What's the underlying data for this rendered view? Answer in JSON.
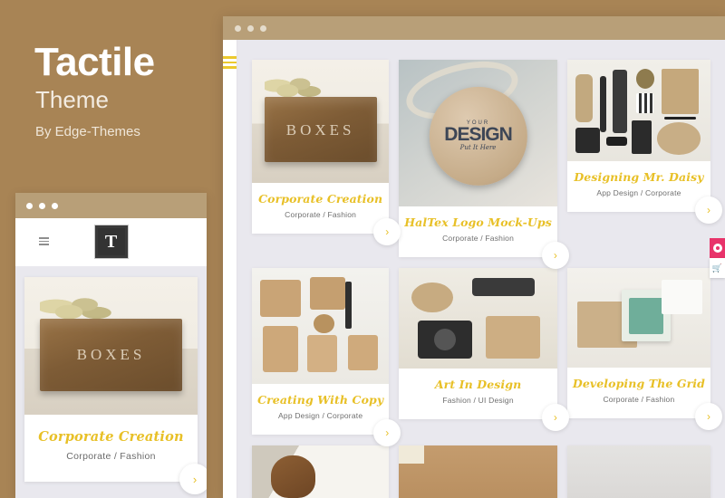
{
  "promo": {
    "title": "Tactile",
    "subtitle": "Theme",
    "byline": "By Edge-Themes"
  },
  "colors": {
    "page_background": "#a88455",
    "browser_chrome": "#b89f78",
    "content_background": "#e9e8ee",
    "accent_gold": "#e8c027",
    "envato_pink": "#e8336a",
    "logo_dark": "#333333"
  },
  "mobile_preview": {
    "window_dots": 3,
    "menu_icon": "hamburger-icon",
    "logo_letter": "T",
    "card": {
      "title": "Corporate Creation",
      "category": "Corporate / Fashion",
      "arrow": "›",
      "image_alt": "wooden BOXES crate with dried flowers"
    }
  },
  "desktop_preview": {
    "window_dots": 3,
    "menu_icon": "hamburger-icon",
    "cards": [
      {
        "title": "Corporate Creation",
        "category": "Corporate / Fashion",
        "arrow": "›",
        "art": "art-box",
        "thumb_height": 136,
        "image_alt": "wooden BOXES crate with dried flowers"
      },
      {
        "title": "HalTex Logo Mock-Ups",
        "category": "Corporate / Fashion",
        "arrow": "›",
        "art": "art-tag",
        "thumb_height": 162,
        "image_alt": "round wooden tag reading YOUR DESIGN Put It Here"
      },
      {
        "title": "Designing Mr. Daisy",
        "category": "App Design / Corporate",
        "arrow": "›",
        "art": "art-flat",
        "thumb_height": 112,
        "image_alt": "flat-lay of rope, hammer, compass, notebook"
      },
      {
        "title": "Creating With Copy",
        "category": "App Design / Corporate",
        "arrow": "›",
        "art": "art-paper",
        "thumb_height": 128,
        "image_alt": "kraft paper boxes and notepad flat-lay"
      },
      {
        "title": "Art In Design",
        "category": "Fashion / UI Design",
        "arrow": "›",
        "art": "art-desk",
        "thumb_height": 111,
        "image_alt": "camera, glasses and rope on desk"
      },
      {
        "title": "Developing The Grid",
        "category": "Corporate / Fashion",
        "arrow": "›",
        "art": "art-green",
        "thumb_height": 110,
        "image_alt": "green branded package box with card"
      }
    ],
    "partial_row": [
      {
        "art": "art-wood2",
        "image_alt": "wooden knob on white surface"
      },
      {
        "art": "art-kraft",
        "image_alt": "kraft cardboard texture"
      },
      {
        "art": "art-gray",
        "image_alt": "light gray product surface"
      }
    ],
    "tag_art": {
      "line1": "YOUR",
      "line2": "DESIGN",
      "line3": "Put It Here"
    },
    "box_art_label": "BOXES"
  },
  "side_buttons": [
    {
      "name": "envato-button",
      "icon": "envato-circle-icon"
    },
    {
      "name": "cart-button",
      "icon": "shopping-cart-icon",
      "glyph": "🛒"
    }
  ]
}
